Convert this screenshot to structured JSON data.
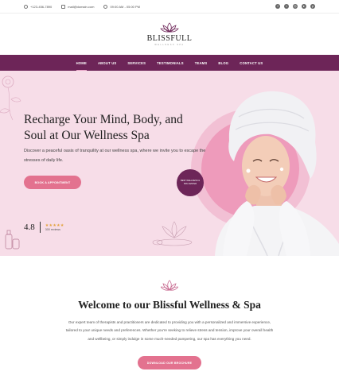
{
  "topbar": {
    "phone": "+123-456-7890",
    "email": "mail@domain.com",
    "hours": "09:00 AM - 05:00 PM",
    "socials": [
      "facebook-icon",
      "twitter-icon",
      "instagram-icon",
      "youtube-icon",
      "pinterest-icon"
    ]
  },
  "logo": {
    "name": "BLISSFULL",
    "tagline": "WELLNESS SPA"
  },
  "nav": {
    "items": [
      "HOME",
      "ABOUT US",
      "SERVICES",
      "TESTIMONIALS",
      "TEAMS",
      "BLOG",
      "CONTACT US"
    ],
    "active": "HOME"
  },
  "hero": {
    "title": "Recharge Your Mind, Body, and Soul at Our Wellness Spa",
    "description": "Discover a peaceful oasis of tranquility at our wellness spa, where we invite you to escape the stresses of daily life.",
    "cta": "BOOK A APPOINTMENT",
    "rating": {
      "score": "4.8",
      "stars": "★★★★★",
      "count": "300 reviews"
    },
    "badge": "BEST WELLNESS & SPA CENTER"
  },
  "welcome": {
    "title": "Welcome to our Blissful Wellness & Spa",
    "text": "Our expert team of therapists and practitioners are dedicated to providing you with a personalized and immersive experience, tailored to your unique needs and preferences. Whether you're seeking to relieve stress and tension, improve your overall health and wellbeing, or simply indulge in some much-needed pampering, our spa has everything you need.",
    "cta": "DOWNLOAD OUR BROCHURE"
  },
  "colors": {
    "brand": "#6d2558",
    "accent": "#e3728f",
    "hero_bg": "#f7dde8"
  }
}
